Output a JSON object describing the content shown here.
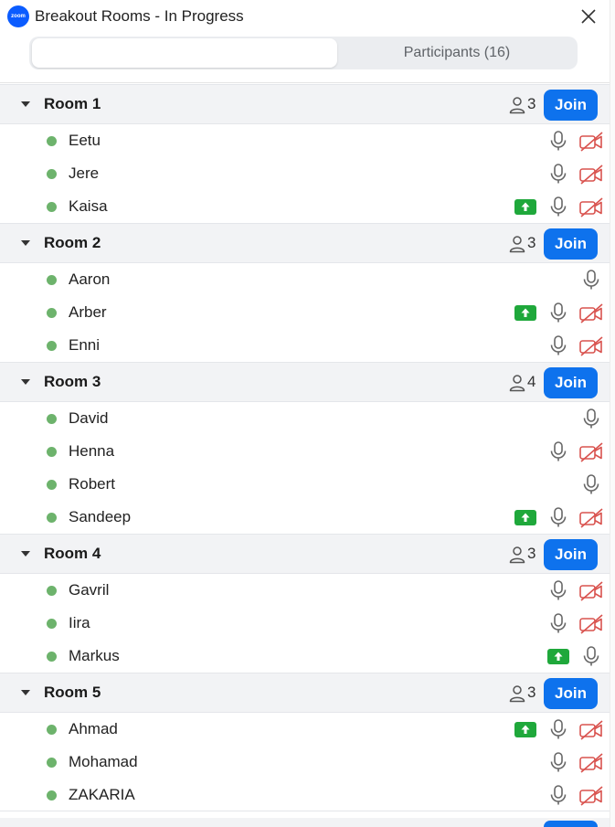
{
  "window": {
    "title": "Breakout Rooms - In Progress",
    "logo_text": "zoom"
  },
  "tabs": [
    {
      "label": "",
      "active": true
    },
    {
      "label": "Participants (16)",
      "active": false
    }
  ],
  "colors": {
    "join": "#0e72ed",
    "online_dot": "#6db36c",
    "share": "#1fa83b",
    "video_off": "#d9534f"
  },
  "rooms": [
    {
      "name": "Room 1",
      "count": "3",
      "join_label": "Join",
      "members": [
        {
          "name": "Eetu",
          "share": false,
          "mic": true,
          "video_off": true
        },
        {
          "name": "Jere",
          "share": false,
          "mic": true,
          "video_off": true
        },
        {
          "name": "Kaisa",
          "share": true,
          "mic": true,
          "video_off": true
        }
      ]
    },
    {
      "name": "Room 2",
      "count": "3",
      "join_label": "Join",
      "members": [
        {
          "name": "Aaron",
          "share": false,
          "mic": true,
          "video_off": false
        },
        {
          "name": "Arber",
          "share": true,
          "mic": true,
          "video_off": true
        },
        {
          "name": "Enni",
          "share": false,
          "mic": true,
          "video_off": true
        }
      ]
    },
    {
      "name": "Room 3",
      "count": "4",
      "join_label": "Join",
      "members": [
        {
          "name": "David",
          "share": false,
          "mic": true,
          "video_off": false
        },
        {
          "name": "Henna",
          "share": false,
          "mic": true,
          "video_off": true
        },
        {
          "name": "Robert",
          "share": false,
          "mic": true,
          "video_off": false
        },
        {
          "name": "Sandeep",
          "share": true,
          "mic": true,
          "video_off": true
        }
      ]
    },
    {
      "name": "Room 4",
      "count": "3",
      "join_label": "Join",
      "members": [
        {
          "name": "Gavril",
          "share": false,
          "mic": true,
          "video_off": true
        },
        {
          "name": "Iira",
          "share": false,
          "mic": true,
          "video_off": true
        },
        {
          "name": "Markus",
          "share": true,
          "mic": true,
          "video_off": false
        }
      ]
    },
    {
      "name": "Room 5",
      "count": "3",
      "join_label": "Join",
      "members": [
        {
          "name": "Ahmad",
          "share": true,
          "mic": true,
          "video_off": true
        },
        {
          "name": "Mohamad",
          "share": false,
          "mic": true,
          "video_off": true
        },
        {
          "name": "ZAKARIA",
          "share": false,
          "mic": true,
          "video_off": true
        }
      ]
    }
  ]
}
